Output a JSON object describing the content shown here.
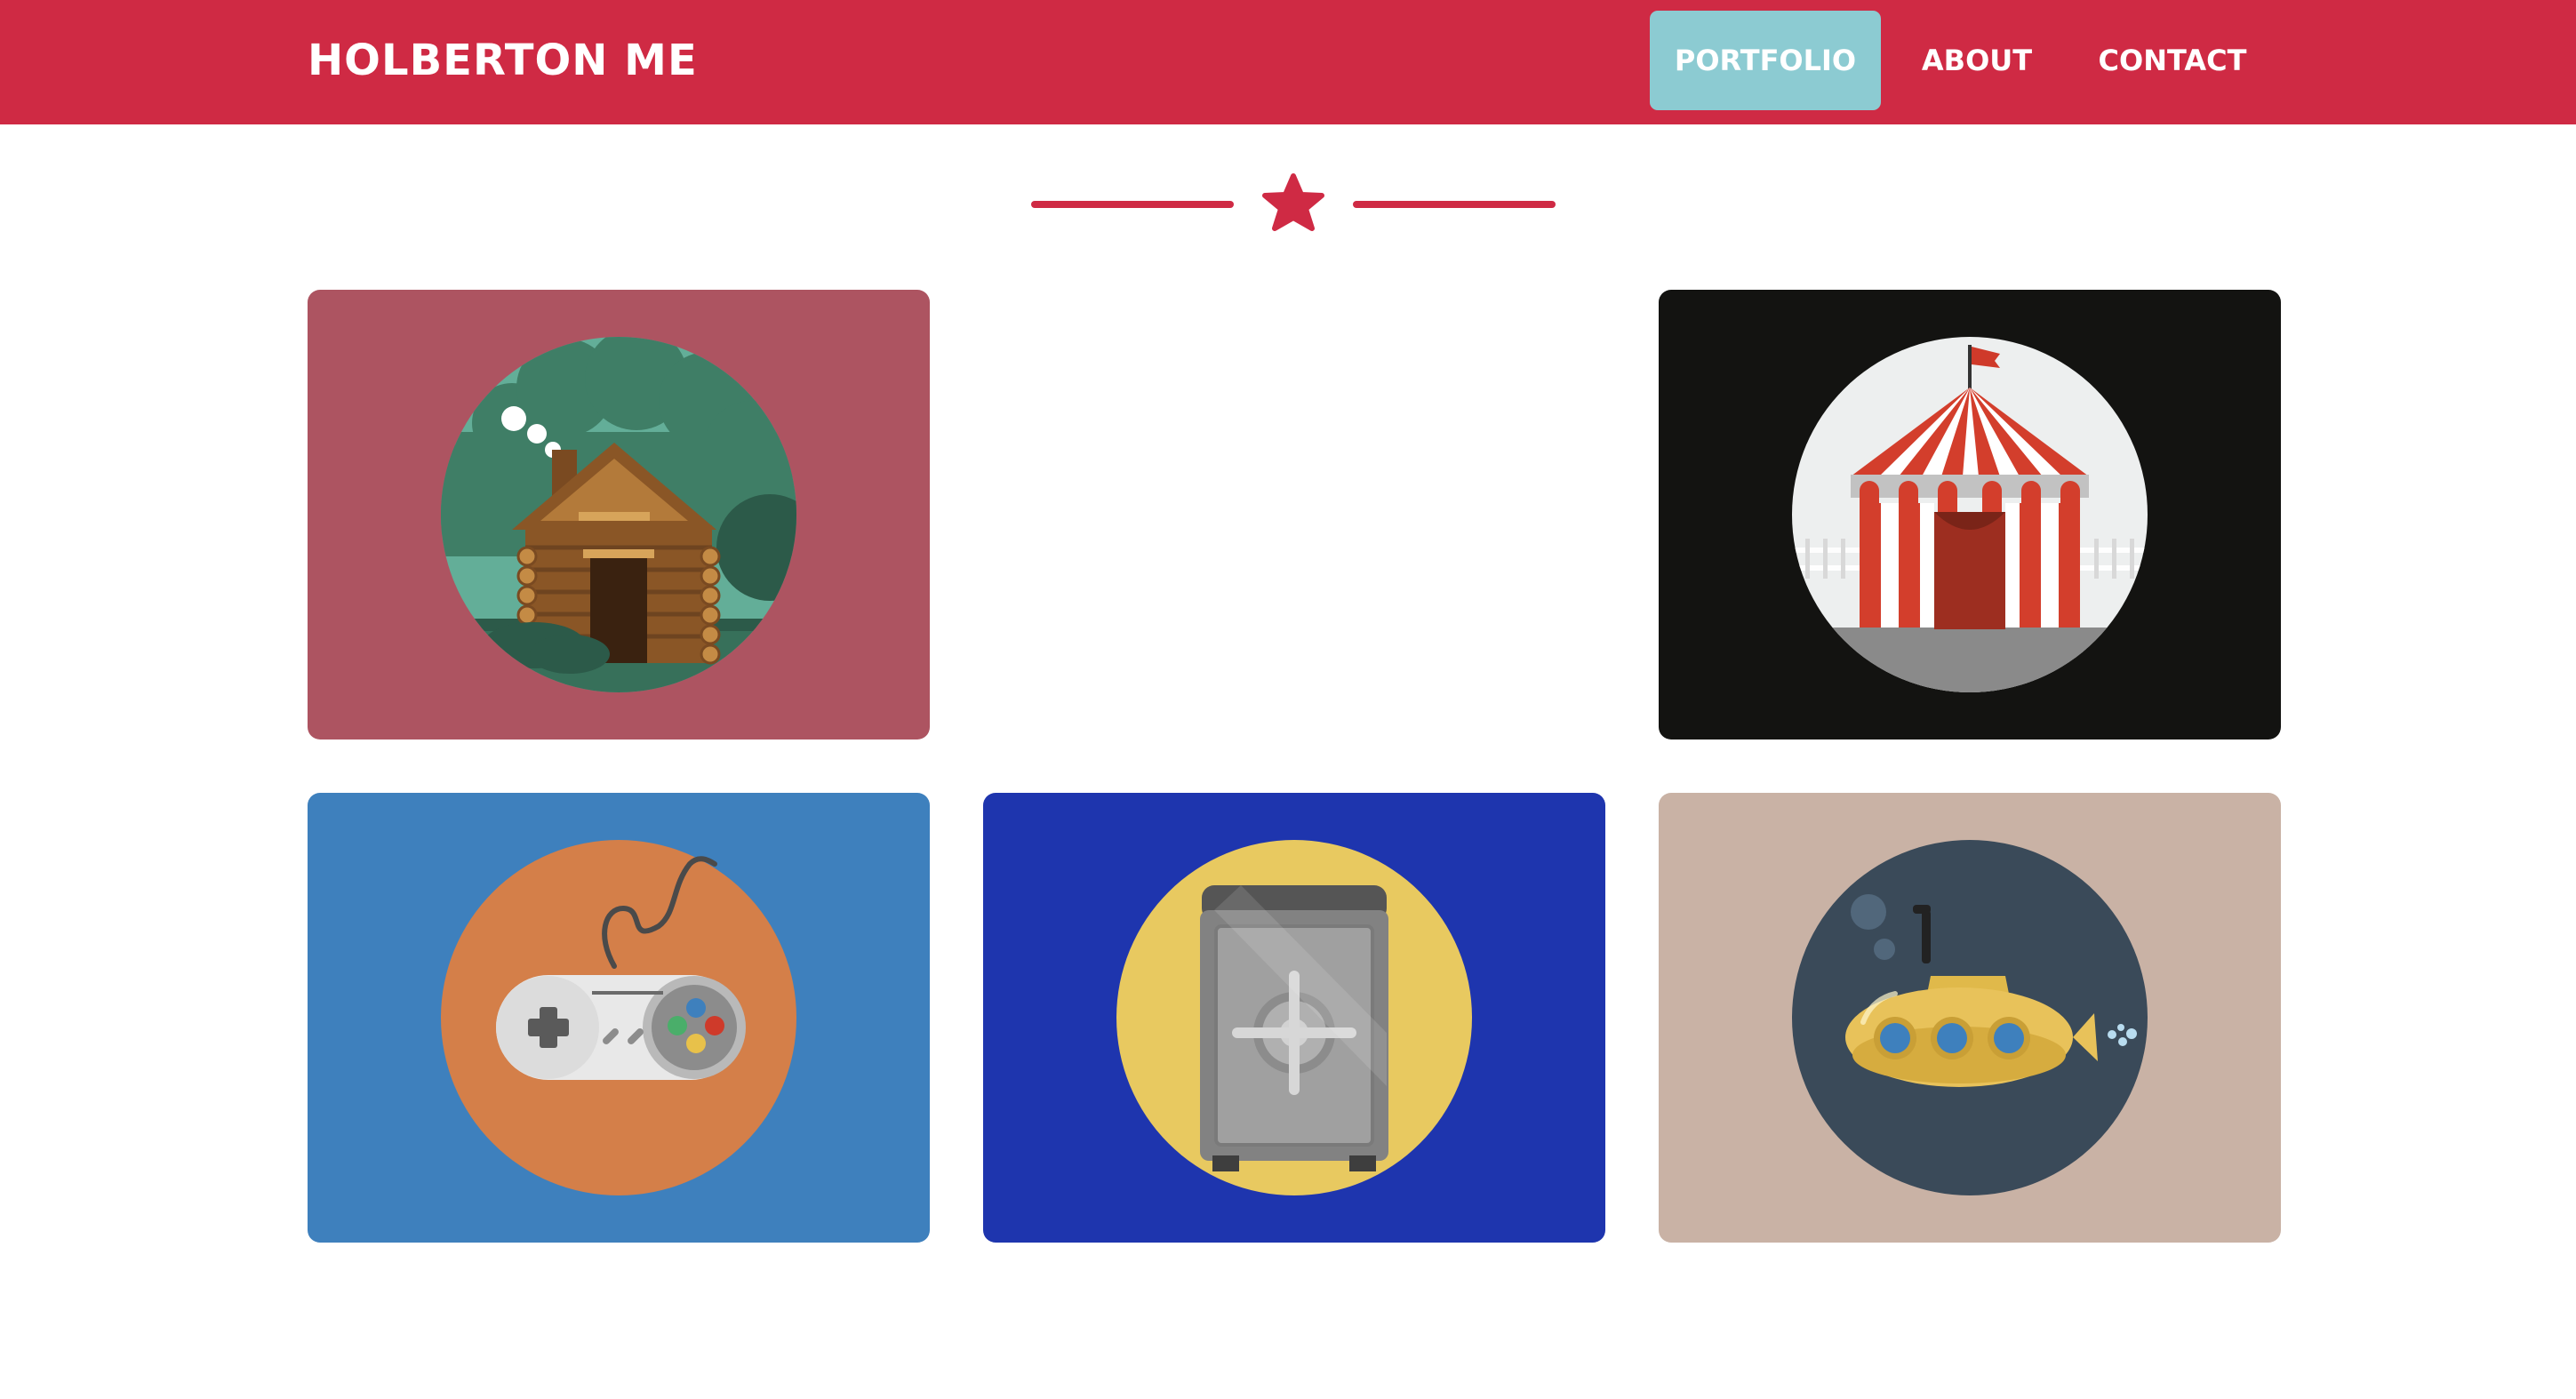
{
  "navbar": {
    "brand": "HOLBERTON ME",
    "background": "#cf2a44",
    "items": [
      {
        "label": "PORTFOLIO",
        "active": true
      },
      {
        "label": "ABOUT",
        "active": false
      },
      {
        "label": "CONTACT",
        "active": false
      }
    ],
    "active_color": "#8ccbd2"
  },
  "divider": {
    "icon": "star-icon",
    "color": "#cf2a44"
  },
  "portfolio": {
    "cards": [
      {
        "illustration": "log-cabin-icon",
        "background": "#ad5461",
        "circle": "#63ae98"
      },
      {
        "illustration": "circus-tent-icon",
        "background": "#131311",
        "circle": "#edefef"
      },
      {
        "illustration": "game-controller-icon",
        "background": "#3e80bd",
        "circle": "#d47f49"
      },
      {
        "illustration": "safe-icon",
        "background": "#1e35ae",
        "circle": "#e8c960"
      },
      {
        "illustration": "submarine-icon",
        "background": "#c9b2a5",
        "circle": "#3a4a59"
      }
    ]
  }
}
